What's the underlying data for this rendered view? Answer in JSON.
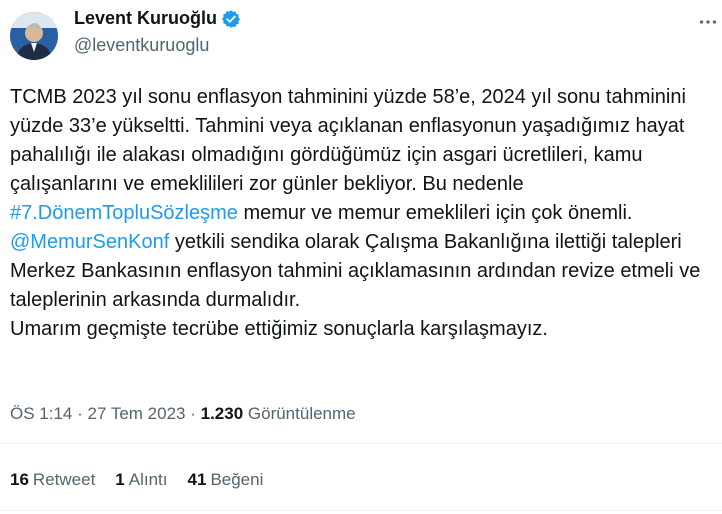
{
  "author": {
    "name": "Levent Kuruoğlu",
    "handle": "@leventkuruoglu",
    "verified_color": "#1d9bf0"
  },
  "tweet": {
    "p1_before": "TCMB 2023 yıl sonu enflasyon tahminini yüzde 58’e, 2024 yıl sonu tahminini yüzde 33’e yükseltti. Tahmini veya açıklanan enflasyonun yaşadığımız hayat pahalılığı ile alakası olmadığını gördüğümüz için asgari ücretlileri, kamu çalışanlarını ve emeklilileri zor günler bekliyor. Bu nedenle ",
    "hashtag": "#7.DönemTopluSözleşme",
    "p1_after": " memur ve memur emeklileri için çok önemli.",
    "mention": "@MemurSenKonf",
    "p2_after": " yetkili sendika olarak Çalışma Bakanlığına ilettiği talepleri Merkez Bankasının enflasyon tahmini açıklamasının ardından revize etmeli ve taleplerinin arkasında durmalıdır.",
    "p3": "Umarım geçmişte tecrübe ettiğimiz sonuçlarla karşılaşmayız."
  },
  "meta": {
    "time": "ÖS 1:14",
    "date": "27 Tem 2023",
    "views_count": "1.230",
    "views_label": "Görüntülenme"
  },
  "stats": {
    "retweets_count": "16",
    "retweets_label": "Retweet",
    "quotes_count": "1",
    "quotes_label": "Alıntı",
    "likes_count": "41",
    "likes_label": "Beğeni"
  },
  "icons": {
    "more": "more-horizontal-icon",
    "verified": "verified-badge-icon"
  }
}
